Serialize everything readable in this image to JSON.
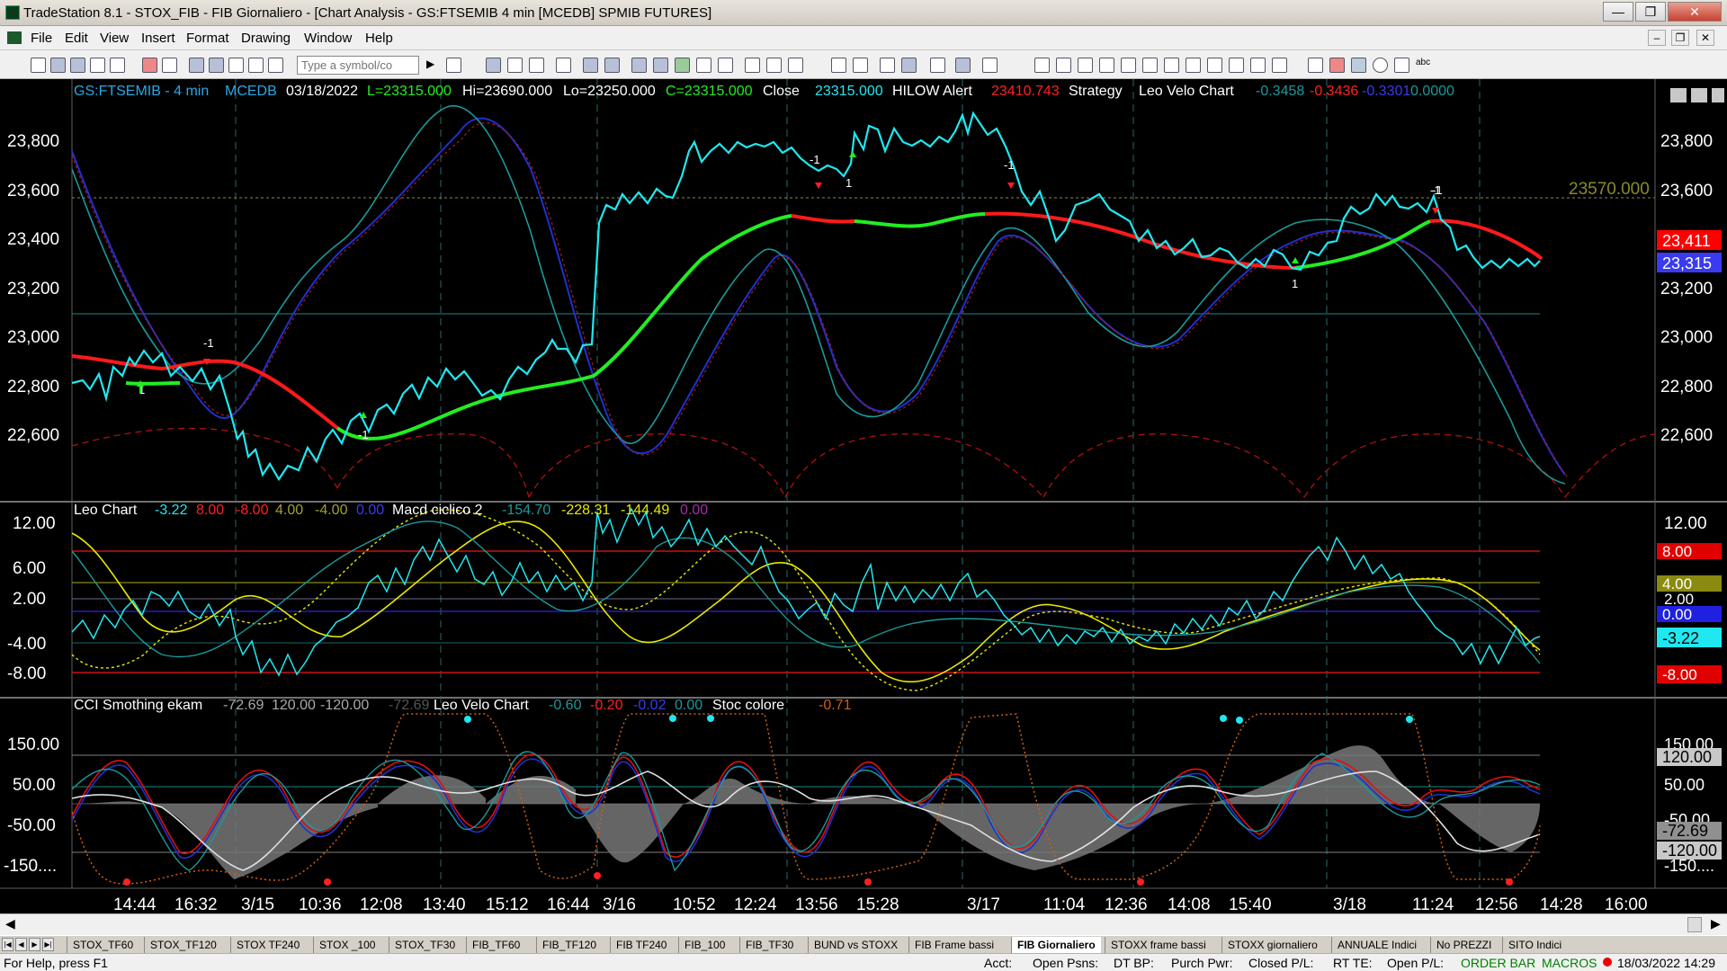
{
  "window": {
    "title": "TradeStation 8.1 - STOX_FIB - FIB Giornaliero - [Chart Analysis - GS:FTSEMIB  4 min  [MCEDB] SPMIB FUTURES]"
  },
  "menu": [
    "File",
    "Edit",
    "View",
    "Insert",
    "Format",
    "Drawing",
    "Window",
    "Help"
  ],
  "toolbar": {
    "symbol_placeholder": "Type a symbol/co"
  },
  "chart": {
    "header1": {
      "symbol": "GS:FTSEMIB - 4 min",
      "feed": "MCEDB",
      "date": "03/18/2022",
      "last": "L=23315.000",
      "high": "Hi=23690.000",
      "low": "Lo=23250.000",
      "close_eq": "C=23315.000",
      "close_label": "Close",
      "close_value": "23315.000",
      "hilow_label": "HILOW Alert",
      "hilow_value": "23410.743",
      "strategy": "Strategy",
      "velo_label": "Leo Velo Chart",
      "velo_v1": "-0.3458",
      "velo_v2": "-0.3436",
      "velo_v3": "-0.3301",
      "velo_v4": "0.0000"
    },
    "header2": {
      "label": "Leo Chart",
      "v1": "-3.22",
      "v2": "8.00",
      "v3": "-8.00",
      "v4": "4.00",
      "v5": "-4.00",
      "v6": "0.00",
      "macd_label": "Macd ciclico 2",
      "m1": "-154.70",
      "m2": "-228.31",
      "m3": "-144.49",
      "m4": "0.00"
    },
    "header3": {
      "label": "CCI Smothing ekam",
      "c1": "-72.69",
      "c2": "120.00",
      "c3": "-120.00",
      "c4": "-72.69",
      "velo_label": "Leo Velo Chart",
      "l1": "-0.60",
      "l2": "-0.20",
      "l3": "-0.02",
      "l4": "0.00",
      "stoc_label": "Stoc colore",
      "s1": "-0.71"
    },
    "price_axis": [
      "23,800",
      "23,600",
      "23,400",
      "23,200",
      "23,000",
      "22,800",
      "22,600"
    ],
    "leo_axis": [
      "12.00",
      "6.00",
      "2.00",
      "-4.00",
      "-8.00"
    ],
    "cci_axis": [
      "150.00",
      "50.00",
      "-50.00",
      "-150...."
    ],
    "price_markers": {
      "level": "23570.000",
      "hilow": "23,411",
      "last": "23,315"
    },
    "leo_markers": {
      "m8": "8.00",
      "m4": "4.00",
      "m2": "2.00",
      "m0": "0.00",
      "cur": "-3.22",
      "mneg8": "-8.00"
    },
    "cci_markers": {
      "m150": "150.00",
      "m120": "120.00",
      "m50": "50.00",
      "mneg50": "-50.00",
      "cur": "-72.69",
      "mneg120": "-120.00",
      "mneg150": "-150...."
    },
    "time_axis": [
      "14:44",
      "16:32",
      "3/15",
      "10:36",
      "12:08",
      "13:40",
      "15:12",
      "16:44",
      "3/16",
      "10:52",
      "12:24",
      "13:56",
      "15:28",
      "3/17",
      "11:04",
      "12:36",
      "14:08",
      "15:40",
      "3/18",
      "11:24",
      "12:56",
      "14:28",
      "16:00"
    ],
    "trade_labels": [
      "-1",
      "-1",
      "-1",
      "1",
      "-1",
      "-1",
      "1",
      "1",
      "-1"
    ],
    "colors": {
      "background": "#000000",
      "price": "#20e8f0",
      "hilow_down": "#ff1a1a",
      "hilow_up": "#22ee22",
      "ma_blue": "#2030d0",
      "ma_teal": "#1a9a9a",
      "leo_yellow": "#e8e800",
      "cycle_red": "#b01010"
    }
  },
  "sheet_tabs": [
    "STOX_TF60",
    "STOX_TF120",
    "STOX TF240",
    "STOX _100",
    "STOX_TF30",
    "FIB_TF60",
    "FIB_TF120",
    "FIB TF240",
    "FIB_100",
    "FIB_TF30",
    "BUND vs STOXX",
    "FIB Frame bassi",
    "FIB Giornaliero",
    "STOXX frame bassi",
    "STOXX giornaliero",
    "ANNUALE Indici",
    "No PREZZI",
    "SITO Indici"
  ],
  "active_tab": "FIB Giornaliero",
  "status": {
    "help": "For Help, press F1",
    "acct": "Acct:",
    "open_psns": "Open Psns:",
    "dt_bp": "DT BP:",
    "purch_pwr": "Purch Pwr:",
    "closed_pl": "Closed P/L:",
    "rt_te": "RT TE:",
    "open_pl": "Open P/L:",
    "order_bar": "ORDER BAR",
    "macros": "MACROS",
    "datetime": "18/03/2022 14:29"
  }
}
